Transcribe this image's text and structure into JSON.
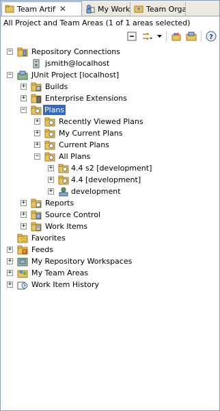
{
  "tabs": [
    {
      "label": "Team Artif",
      "close": "✕"
    },
    {
      "label": "My Work"
    },
    {
      "label": "Team Orga"
    }
  ],
  "status_text": "All Project and Team Areas (1 of 1 areas selected)",
  "toolbar": {
    "collapse_icon": "collapse-all-icon",
    "sync_icon": "link-with-editor-icon",
    "menu_icon": "view-menu-icon",
    "team_icon": "team-area-icon",
    "project_icon": "project-area-icon",
    "help_icon": "help-icon"
  },
  "tree": {
    "repo_connections": "Repository Connections",
    "jsmith": "jsmith@localhost",
    "junit": "JUnit Project [localhost]",
    "builds": "Builds",
    "enterprise": "Enterprise Extensions",
    "plans": "Plans",
    "recent_plans": "Recently Viewed Plans",
    "my_current_plans": "My Current Plans",
    "current_plans": "Current Plans",
    "all_plans": "All Plans",
    "plan_44s2": "4.4 s2 [development]",
    "plan_44": "4.4 [development]",
    "development": "development",
    "reports": "Reports",
    "source_control": "Source Control",
    "work_items": "Work Items",
    "favorites": "Favorites",
    "feeds": "Feeds",
    "my_repo_workspaces": "My Repository Workspaces",
    "my_team_areas": "My Team Areas",
    "work_item_history": "Work Item History"
  },
  "colors": {
    "selection": "#316ac5",
    "folder": "#e8c45c"
  }
}
